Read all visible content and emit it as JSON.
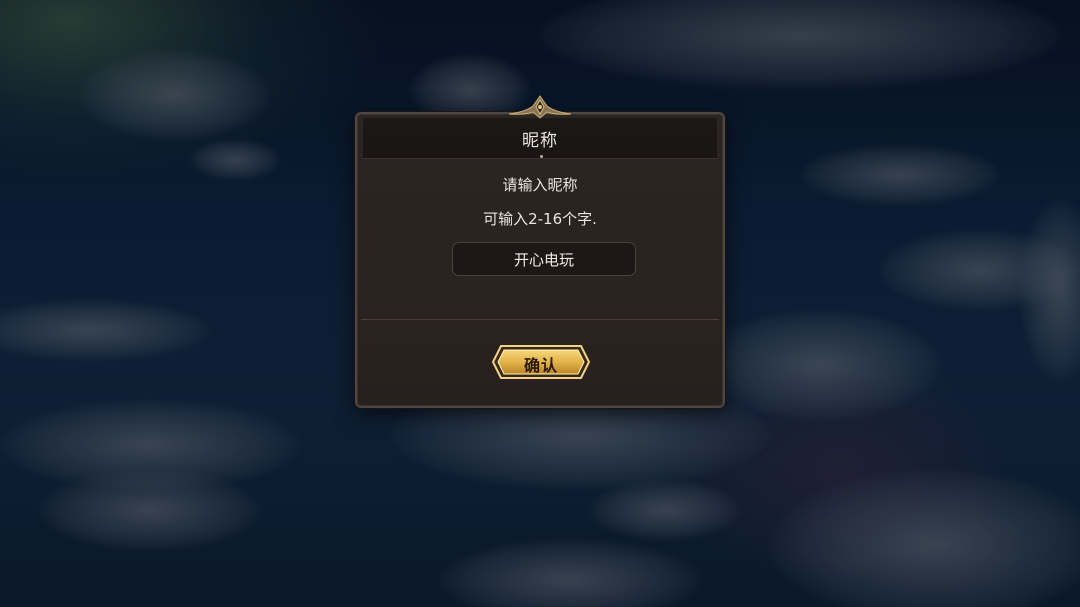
{
  "dialog": {
    "title": "昵称",
    "prompt": "请输入昵称",
    "hint": "可输入2-16个字.",
    "nickname_value": "开心电玩",
    "confirm_label": "确认"
  },
  "colors": {
    "accent_gold": "#e2b44a",
    "panel_bg": "#2a2320",
    "text": "#ebe5dc"
  },
  "icons": [
    "crest-ornament-icon"
  ]
}
